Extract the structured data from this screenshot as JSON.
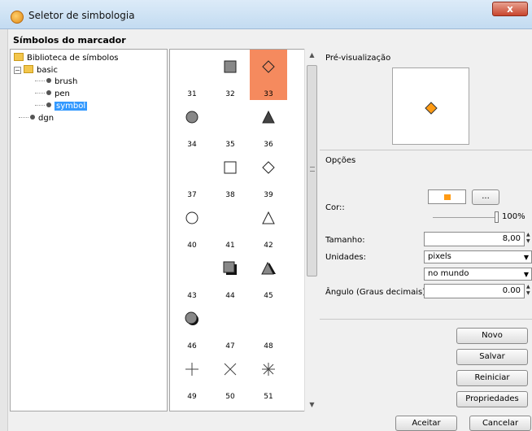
{
  "window": {
    "title": "Seletor de simbologia",
    "close_glyph": "x"
  },
  "section_title": "Símbolos do marcador",
  "tree": {
    "root": "Biblioteca de símbolos",
    "basic": "basic",
    "children": [
      "brush",
      "pen",
      "symbol"
    ],
    "dgn": "dgn",
    "expander": "−"
  },
  "symbols": [
    {
      "num": "31",
      "icon": "none"
    },
    {
      "num": "32",
      "icon": "square-filled"
    },
    {
      "num": "33",
      "icon": "diamond-outline"
    },
    {
      "num": "34",
      "icon": "circle-filled"
    },
    {
      "num": "35",
      "icon": "none"
    },
    {
      "num": "36",
      "icon": "triangle-filled"
    },
    {
      "num": "37",
      "icon": "none"
    },
    {
      "num": "38",
      "icon": "square-outline"
    },
    {
      "num": "39",
      "icon": "diamond-outline"
    },
    {
      "num": "40",
      "icon": "circle-outline"
    },
    {
      "num": "41",
      "icon": "none"
    },
    {
      "num": "42",
      "icon": "triangle-outline"
    },
    {
      "num": "43",
      "icon": "none"
    },
    {
      "num": "44",
      "icon": "square-shadow"
    },
    {
      "num": "45",
      "icon": "triangle-shadow"
    },
    {
      "num": "46",
      "icon": "circle-shadow"
    },
    {
      "num": "47",
      "icon": "none"
    },
    {
      "num": "48",
      "icon": "none"
    },
    {
      "num": "49",
      "icon": "plus"
    },
    {
      "num": "50",
      "icon": "cross"
    },
    {
      "num": "51",
      "icon": "asterisk"
    }
  ],
  "selected_symbol": "33",
  "preview": {
    "label": "Pré-visualização",
    "symbol_color": "#ff9b14"
  },
  "options": {
    "label": "Opções",
    "color_label": "Cor::",
    "color_value": "#ff9b14",
    "color_button": "...",
    "opacity_pct": "100%",
    "size_label": "Tamanho:",
    "size_value": "8,00",
    "units_label": "Unidades:",
    "units_value": "pixels",
    "units_scope": "no mundo",
    "angle_label": "Ângulo (Graus decimais):",
    "angle_value": "0.00"
  },
  "buttons": {
    "novo": "Novo",
    "salvar": "Salvar",
    "reiniciar": "Reiniciar",
    "propriedades": "Propriedades",
    "aceitar": "Aceitar",
    "cancelar": "Cancelar"
  }
}
